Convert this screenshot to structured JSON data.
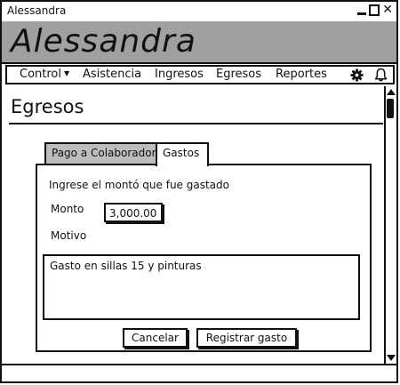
{
  "window": {
    "title": "Alessandra",
    "controls": [
      "minimize-icon",
      "maximize-icon",
      "close-icon"
    ]
  },
  "banner": {
    "brand": "Alessandra"
  },
  "menu": {
    "items": [
      {
        "label": "Control",
        "has_dropdown": true
      },
      {
        "label": "Asistencia"
      },
      {
        "label": "Ingresos"
      },
      {
        "label": "Egresos"
      },
      {
        "label": "Reportes"
      }
    ],
    "icons": [
      "gear-icon",
      "bell-icon"
    ]
  },
  "page": {
    "title": "Egresos"
  },
  "tabs": {
    "items": [
      {
        "label": "Pago a Colaborador",
        "active": false
      },
      {
        "label": "Gastos",
        "active": true
      }
    ]
  },
  "form": {
    "instruction": "Ingrese el montó que fue gastado",
    "monto_label": "Monto",
    "monto_value": "3,000.00",
    "motivo_label": "Motivo",
    "motivo_value": "Gasto en sillas 15 y pinturas",
    "cancel_label": "Cancelar",
    "submit_label": "Registrar gasto"
  },
  "colors": {
    "banner_bg": "#a0a0a0",
    "inactive_tab_bg": "#bdbdbd",
    "ink": "#111111"
  }
}
